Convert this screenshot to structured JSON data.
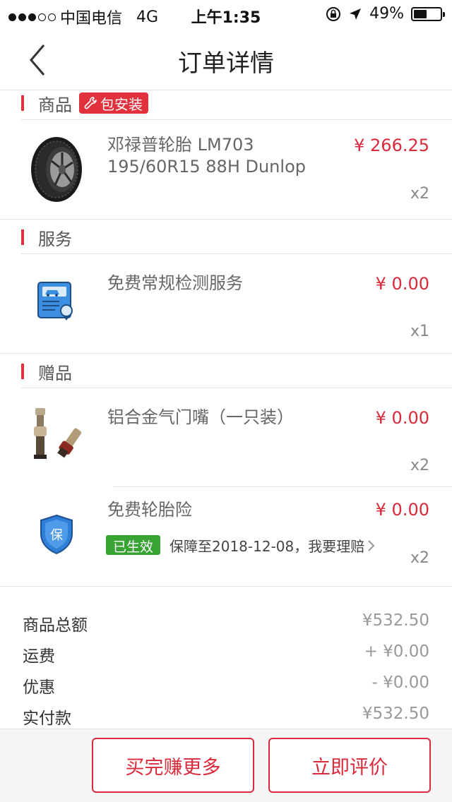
{
  "status_bar": {
    "carrier": "中国电信",
    "network": "4G",
    "time": "上午1:35",
    "battery": "49%",
    "battery_level": 0.49
  },
  "nav": {
    "title": "订单详情"
  },
  "sections": {
    "goods": {
      "label": "商品",
      "badge": "包安装"
    },
    "services": {
      "label": "服务"
    },
    "gifts": {
      "label": "赠品"
    }
  },
  "goods_item": {
    "name_line1": "邓禄普轮胎 LM703",
    "name_line2": "195/60R15 88H Dunlop",
    "price": "¥ 266.25",
    "qty": "x2"
  },
  "service_item": {
    "name": "免费常规检测服务",
    "price": "¥ 0.00",
    "qty": "x1"
  },
  "gift_items": [
    {
      "name": "铝合金气门嘴（一只装）",
      "price": "¥ 0.00",
      "qty": "x2"
    },
    {
      "name": "免费轮胎险",
      "price": "¥ 0.00",
      "qty": "x2",
      "status_badge": "已生效",
      "coverage": "保障至2018-12-08，我要理赔",
      "insurance_icon_text": "保"
    }
  ],
  "summary": [
    {
      "label": "商品总额",
      "value": "¥532.50"
    },
    {
      "label": "运费",
      "value": "+ ¥0.00"
    },
    {
      "label": "优惠",
      "value": "- ¥0.00"
    },
    {
      "label": "实付款",
      "value": "¥532.50"
    }
  ],
  "footer": {
    "buy_more": "买完赚更多",
    "review": "立即评价"
  },
  "colors": {
    "accent": "#d9293a",
    "effective": "#3aa336"
  }
}
